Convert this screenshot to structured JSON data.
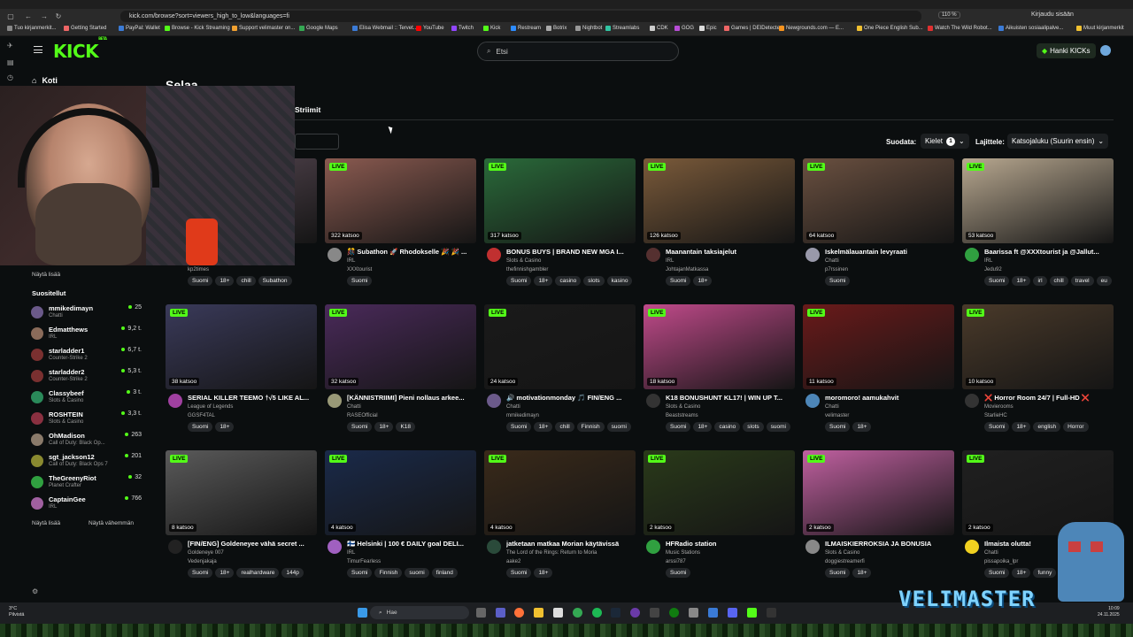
{
  "browser": {
    "url": "kick.com/browse?sort=viewers_high_to_low&languages=fi",
    "zoom": "110 %",
    "signin": "Kirjaudu sisään",
    "bookmarks": [
      {
        "label": "Tuo kirjanmerkit...",
        "color": "#888"
      },
      {
        "label": "Getting Started",
        "color": "#e66"
      },
      {
        "label": "PayPal: Wallet",
        "color": "#3b7bd6"
      },
      {
        "label": "Browse - Kick Streaming",
        "color": "#53fc18"
      },
      {
        "label": "Support velimaster on...",
        "color": "#f0a030"
      },
      {
        "label": "Google Maps",
        "color": "#34a853"
      },
      {
        "label": "Elisa Webmail :: Tervet...",
        "color": "#3b7bd6"
      },
      {
        "label": "YouTube",
        "color": "#f00"
      },
      {
        "label": "Twitch",
        "color": "#9146ff"
      },
      {
        "label": "Kick",
        "color": "#53fc18"
      },
      {
        "label": "Restream",
        "color": "#2d8cff"
      },
      {
        "label": "Botrix",
        "color": "#aaa"
      },
      {
        "label": "Nightbot",
        "color": "#999"
      },
      {
        "label": "Streamlabs",
        "color": "#31c3a2"
      },
      {
        "label": "CDK",
        "color": "#ccc"
      },
      {
        "label": "GOG",
        "color": "#b84dd6"
      },
      {
        "label": "Epic",
        "color": "#ddd"
      },
      {
        "label": "Games | DEIDetected",
        "color": "#e66"
      },
      {
        "label": "Newgrounds.com — E...",
        "color": "#f7931e"
      },
      {
        "label": "One Piece English Sub...",
        "color": "#f0c030"
      },
      {
        "label": "Watch The Wild Robot...",
        "color": "#e03030"
      },
      {
        "label": "Aikuisten sosiaalipalve...",
        "color": "#3b7bd6"
      },
      {
        "label": "Muut kirjanmerkit",
        "color": "#f0c030"
      }
    ]
  },
  "header": {
    "logo": "KICK",
    "logo_sup": "BETA",
    "search_placeholder": "Etsi",
    "kicks_button": "Hanki KICKs"
  },
  "sidebar": {
    "home": "Koti",
    "show_more": "Näytä lisää",
    "recommended_title": "Suositellut",
    "show_less": "Näytä vähemmän",
    "items": [
      {
        "name": "mmikedimayn",
        "category": "Chatti",
        "viewers": "25",
        "color": "#6b5a8a"
      },
      {
        "name": "Edmatthews",
        "category": "IRL",
        "viewers": "9,2 t.",
        "color": "#8a6b5a"
      },
      {
        "name": "starladder1",
        "category": "Counter-Strike 2",
        "viewers": "6,7 t.",
        "color": "#7a3030"
      },
      {
        "name": "starladder2",
        "category": "Counter-Strike 2",
        "viewers": "5,3 t.",
        "color": "#7a3030"
      },
      {
        "name": "Classybeef",
        "category": "Slots & Casino",
        "viewers": "3 t.",
        "color": "#2a8a5a"
      },
      {
        "name": "ROSHTEIN",
        "category": "Slots & Casino",
        "viewers": "3,3 t.",
        "color": "#8a3040"
      },
      {
        "name": "OhMadison",
        "category": "Call of Duty: Black Op...",
        "viewers": "263",
        "color": "#8a7a6a"
      },
      {
        "name": "sgt_jackson12",
        "category": "Call of Duty: Black Ops 7",
        "viewers": "201",
        "color": "#8a8a30"
      },
      {
        "name": "TheGreenyRiot",
        "category": "Planet Crafter",
        "viewers": "32",
        "color": "#30a040"
      },
      {
        "name": "CaptainGee",
        "category": "IRL",
        "viewers": "766",
        "color": "#a060a0"
      }
    ]
  },
  "main": {
    "title": "Selaa",
    "tab": "Striimit",
    "filter_label": "Suodata:",
    "languages_button": "Kielet",
    "languages_count": "1",
    "sort_label": "Lajittele:",
    "sort_value": "Katsojaluku (Suurin ensin)",
    "live_label": "LIVE",
    "cards": [
      {
        "title": "...",
        "category": "",
        "user": "kp2times",
        "viewers": "",
        "tags": [
          "Suomi",
          "18+",
          "chill",
          "Subathon"
        ],
        "thumb": "#5a4a55",
        "av": "#777"
      },
      {
        "title": "🎊 Subathon 🚀 Rhodokselle 🎉 🎉 ...",
        "category": "IRL",
        "user": "XXXtourist",
        "viewers": "322 katsoo",
        "tags": [
          "Suomi"
        ],
        "thumb": "#8a5a50",
        "av": "#888"
      },
      {
        "title": "BONUS BUYS | BRAND NEW MGA I...",
        "category": "Slots & Casino",
        "user": "thefinnishgambler",
        "viewers": "317 katsoo",
        "tags": [
          "Suomi",
          "18+",
          "casino",
          "slots",
          "kasino"
        ],
        "thumb": "#2a6a3a",
        "av": "#c03030"
      },
      {
        "title": "Maanantain taksiajelut",
        "category": "IRL",
        "user": "JohtajanMatkassa",
        "viewers": "126 katsoo",
        "tags": [
          "Suomi",
          "18+"
        ],
        "thumb": "#7a5a3a",
        "av": "#553030"
      },
      {
        "title": "Iskelmälauantain levyraati",
        "category": "Chatti",
        "user": "p7rssinen",
        "viewers": "64 katsoo",
        "tags": [
          "Suomi"
        ],
        "thumb": "#6a5040",
        "av": "#99a"
      },
      {
        "title": "Baarissa ft @XXXtourist ja @Jallut...",
        "category": "IRL",
        "user": "Jedu92",
        "viewers": "53 katsoo",
        "tags": [
          "Suomi",
          "18+",
          "irl",
          "chill",
          "travel",
          "eu"
        ],
        "thumb": "#b8a890",
        "av": "#30a040"
      },
      {
        "title": "SERIAL KILLER TEEMO †√5 LIKE AL...",
        "category": "League of Legends",
        "user": "GGSF4TAL",
        "viewers": "38 katsoo",
        "tags": [
          "Suomi",
          "18+"
        ],
        "thumb": "#3a3a5a",
        "av": "#a040a0"
      },
      {
        "title": "[KÄNNISTRIIMI] Pieni nollaus arkee...",
        "category": "Chatti",
        "user": "RASEOfficial",
        "viewers": "32 katsoo",
        "tags": [
          "Suomi",
          "18+",
          "K18"
        ],
        "thumb": "#4a2a5a",
        "av": "#997"
      },
      {
        "title": "🔊 motivationmonday 🎵 FIN/ENG ...",
        "category": "Chatti",
        "user": "mmikedimayn",
        "viewers": "24 katsoo",
        "tags": [
          "Suomi",
          "18+",
          "chill",
          "Finnish",
          "suomi"
        ],
        "thumb": "#1a1a1a",
        "av": "#6b5a8a"
      },
      {
        "title": "K18 BONUSHUNT KL17! | WIN UP T...",
        "category": "Slots & Casino",
        "user": "Beaststreams",
        "viewers": "18 katsoo",
        "tags": [
          "Suomi",
          "18+",
          "casino",
          "slots",
          "suomi"
        ],
        "thumb": "#c04a8a",
        "av": "#333"
      },
      {
        "title": "moromoro! aamukahvit",
        "category": "Chatti",
        "user": "velimaster",
        "viewers": "11 katsoo",
        "tags": [
          "Suomi",
          "18+"
        ],
        "thumb": "#6a1a1a",
        "av": "#4d86b8"
      },
      {
        "title": "❌ Horror Room 24/7 | Full-HD ❌",
        "category": "Movierooms",
        "user": "StarlieHC",
        "viewers": "10 katsoo",
        "tags": [
          "Suomi",
          "18+",
          "english",
          "Horror"
        ],
        "thumb": "#4a3a2a",
        "av": "#333"
      },
      {
        "title": "[FIN/ENG] Goldeneyee vähä secret ...",
        "category": "Goldeneye 007",
        "user": "Vedenjakaja",
        "viewers": "8 katsoo",
        "tags": [
          "Suomi",
          "18+",
          "realhardware",
          "144p"
        ],
        "thumb": "#5a5a5a",
        "av": "#222"
      },
      {
        "title": "🇫🇮 Helsinki | 100 € DAILY goal DELI...",
        "category": "IRL",
        "user": "TimurFearless",
        "viewers": "4 katsoo",
        "tags": [
          "Suomi",
          "Finnish",
          "suomi",
          "finland"
        ],
        "thumb": "#1a2a4a",
        "av": "#a060c0"
      },
      {
        "title": "jatketaan matkaa Morian käytävissä",
        "category": "The Lord of the Rings: Return to Moria",
        "user": "aake2",
        "viewers": "4 katsoo",
        "tags": [
          "Suomi",
          "18+"
        ],
        "thumb": "#3a2a1a",
        "av": "#2a4a3a"
      },
      {
        "title": "HFRadio station",
        "category": "Music Stations",
        "user": "arssi787",
        "viewers": "2 katsoo",
        "tags": [
          "Suomi"
        ],
        "thumb": "#2a3a1a",
        "av": "#30a040"
      },
      {
        "title": "ILMAISKIERROKSIA JA BONUSIA",
        "category": "Slots & Casino",
        "user": "doggiestreamerfi",
        "viewers": "2 katsoo",
        "tags": [
          "Suomi",
          "18+"
        ],
        "thumb": "#c060a0",
        "av": "#888"
      },
      {
        "title": "Ilmaista olutta!",
        "category": "Chatti",
        "user": "pissapoika_lpr",
        "viewers": "2 katsoo",
        "tags": [
          "Suomi",
          "18+",
          "funny"
        ],
        "thumb": "#202020",
        "av": "#f0d020"
      }
    ]
  },
  "taskbar": {
    "weather_temp": "3°C",
    "weather_text": "Pilvistä",
    "search": "Hae",
    "time": "10:09",
    "date": "24.11.2025"
  },
  "overlay": {
    "brand": "VELIMASTER"
  }
}
